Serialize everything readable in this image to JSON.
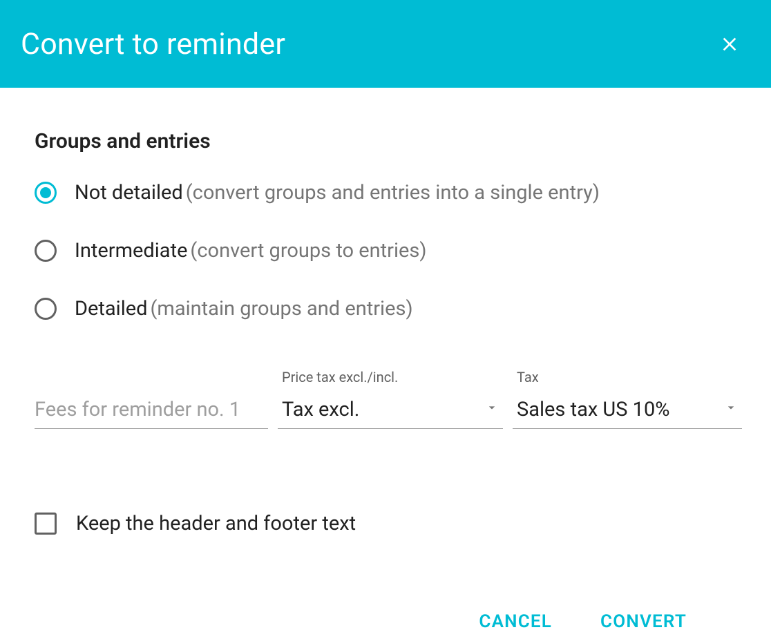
{
  "header": {
    "title": "Convert to reminder"
  },
  "section": {
    "title": "Groups and entries"
  },
  "options": {
    "not_detailed": {
      "label": "Not detailed",
      "hint": "(convert groups and entries into a single entry)"
    },
    "intermediate": {
      "label": "Intermediate",
      "hint": "(convert groups to entries)"
    },
    "detailed": {
      "label": "Detailed",
      "hint": "(maintain groups and entries)"
    }
  },
  "fields": {
    "fee": {
      "placeholder": "Fees for reminder no. 1",
      "value": ""
    },
    "price": {
      "label": "Price tax excl./incl.",
      "value": "Tax excl."
    },
    "tax": {
      "label": "Tax",
      "value": "Sales tax US 10%"
    }
  },
  "checkbox": {
    "keep_text": "Keep the header and footer text"
  },
  "actions": {
    "cancel": "CANCEL",
    "convert": "CONVERT"
  }
}
